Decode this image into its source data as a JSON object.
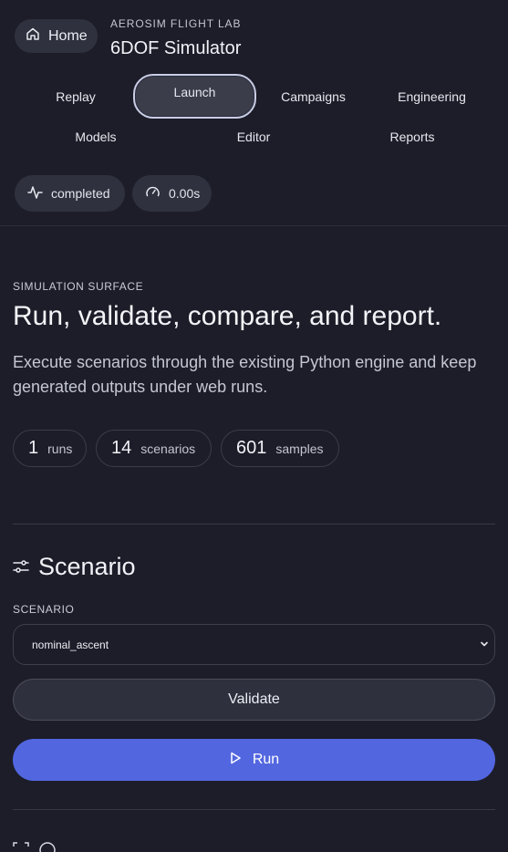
{
  "header": {
    "home_label": "Home",
    "eyebrow": "AEROSIM FLIGHT LAB",
    "title": "6DOF Simulator"
  },
  "nav": {
    "items": [
      {
        "label": "Replay"
      },
      {
        "label": "Launch",
        "active": true
      },
      {
        "label": "Campaigns"
      },
      {
        "label": "Engineering"
      },
      {
        "label": "Models"
      },
      {
        "label": "Editor"
      },
      {
        "label": "Reports"
      }
    ]
  },
  "status": {
    "state": "completed",
    "elapsed": "0.00s"
  },
  "hero": {
    "eyebrow": "SIMULATION SURFACE",
    "title": "Run, validate, compare, and report.",
    "description": "Execute scenarios through the existing Python engine and keep generated outputs under web runs."
  },
  "stats": [
    {
      "value": "1",
      "label": "runs"
    },
    {
      "value": "14",
      "label": "scenarios"
    },
    {
      "value": "601",
      "label": "samples"
    }
  ],
  "scenario_panel": {
    "title": "Scenario",
    "field_label": "SCENARIO",
    "selected": "nominal_ascent",
    "validate_label": "Validate",
    "run_label": "Run"
  },
  "colors": {
    "background": "#1c1d28",
    "accent": "#5266e0",
    "chip": "#2f313e"
  }
}
